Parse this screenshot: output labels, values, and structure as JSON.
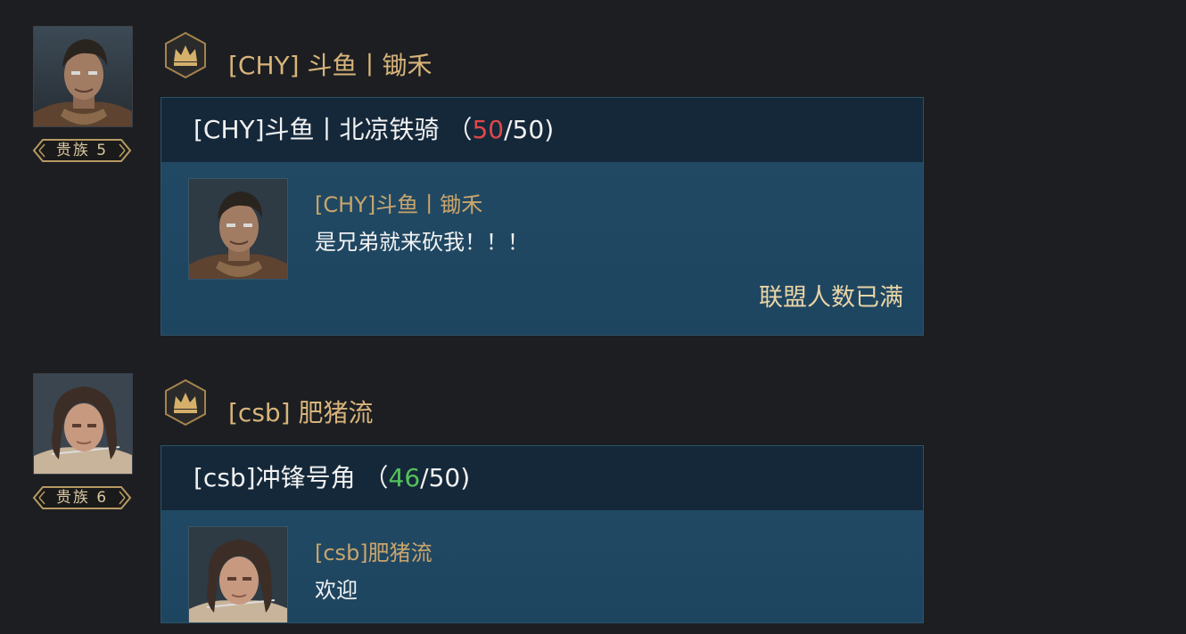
{
  "messages": [
    {
      "sender": "[CHY] 斗鱼丨锄禾",
      "rank_label": "贵族 5",
      "alliance": {
        "name": "[CHY]斗鱼丨北凉铁骑",
        "member_count": "50",
        "member_max": "/50",
        "count_status": "full",
        "leader": "[CHY]斗鱼丨锄禾",
        "slogan": "是兄弟就来砍我！！！",
        "status": "联盟人数已满"
      }
    },
    {
      "sender": "[csb] 肥猪流",
      "rank_label": "贵族 6",
      "alliance": {
        "name": "[csb]冲锋号角",
        "member_count": "46",
        "member_max": "/50",
        "count_status": "open",
        "leader": "[csb]肥猪流",
        "slogan": "欢迎"
      }
    }
  ],
  "colors": {
    "background": "#1c1e22",
    "sender_gold": "#d8b47a",
    "count_full": "#e0484a",
    "count_open": "#53c25a",
    "card_header": "#15283a",
    "card_body": "#1f4257"
  },
  "icons": {
    "alliance_rank": "crown-icon",
    "rank_badge": "noble-rank-badge"
  }
}
